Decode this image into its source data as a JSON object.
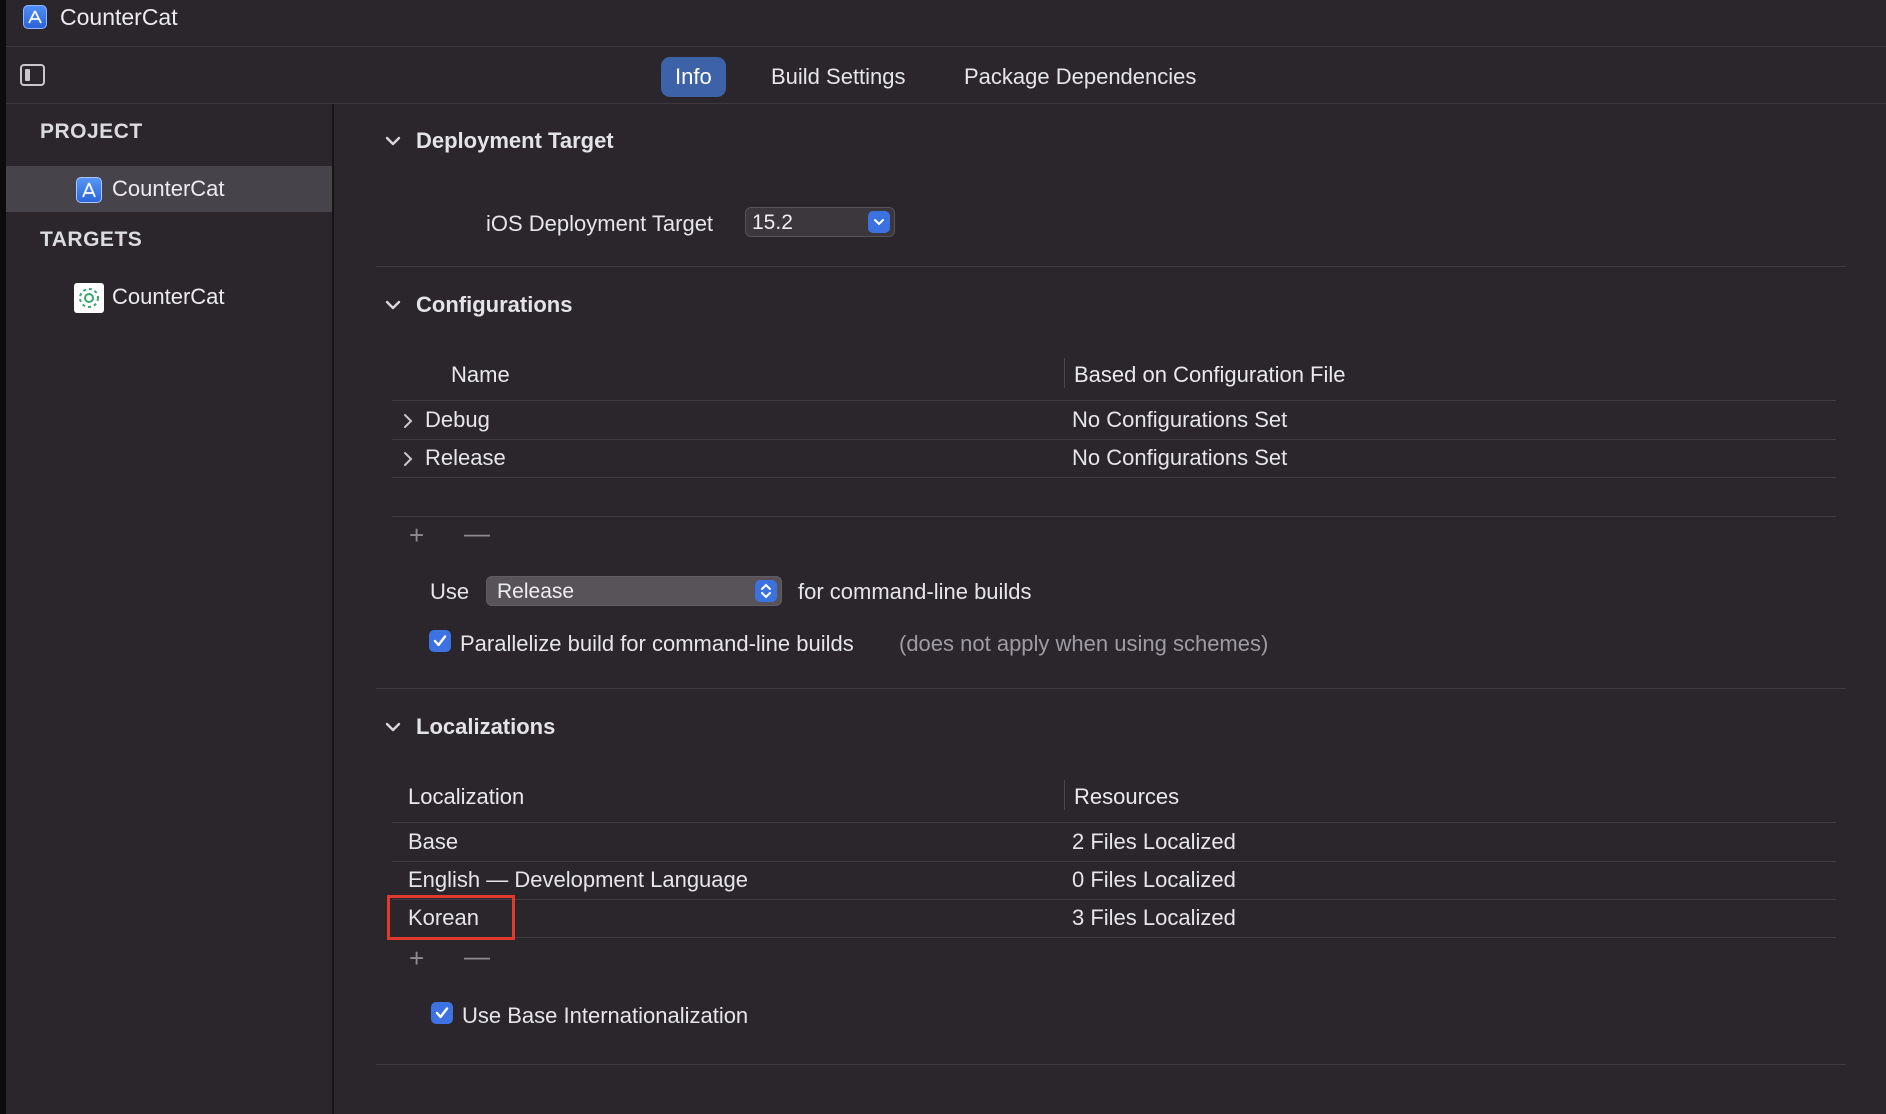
{
  "window": {
    "title": "CounterCat"
  },
  "tabs": [
    {
      "label": "Info",
      "active": true
    },
    {
      "label": "Build Settings",
      "active": false
    },
    {
      "label": "Package Dependencies",
      "active": false
    }
  ],
  "sidebar": {
    "project_heading": "PROJECT",
    "project_item": "CounterCat",
    "targets_heading": "TARGETS",
    "target_item": "CounterCat"
  },
  "deployment": {
    "heading": "Deployment Target",
    "ios_label": "iOS Deployment Target",
    "ios_value": "15.2"
  },
  "configurations": {
    "heading": "Configurations",
    "columns": [
      "Name",
      "Based on Configuration File"
    ],
    "rows": [
      {
        "name": "Debug",
        "file": "No Configurations Set"
      },
      {
        "name": "Release",
        "file": "No Configurations Set"
      }
    ],
    "add": "+",
    "remove": "—",
    "use_label": "Use",
    "use_value": "Release",
    "use_suffix": "for command-line builds",
    "parallelize_label": "Parallelize build for command-line builds",
    "parallelize_note": "(does not apply when using schemes)",
    "parallelize_checked": true
  },
  "localizations": {
    "heading": "Localizations",
    "columns": [
      "Localization",
      "Resources"
    ],
    "rows": [
      {
        "name": "Base",
        "resources": "2 Files Localized"
      },
      {
        "name": "English — Development Language",
        "resources": "0 Files Localized"
      },
      {
        "name": "Korean",
        "resources": "3 Files Localized"
      }
    ],
    "add": "+",
    "remove": "—",
    "base_intl_label": "Use Base Internationalization",
    "base_intl_checked": true
  },
  "colors": {
    "accent": "#3c72e2",
    "highlight": "#e03a2c"
  }
}
